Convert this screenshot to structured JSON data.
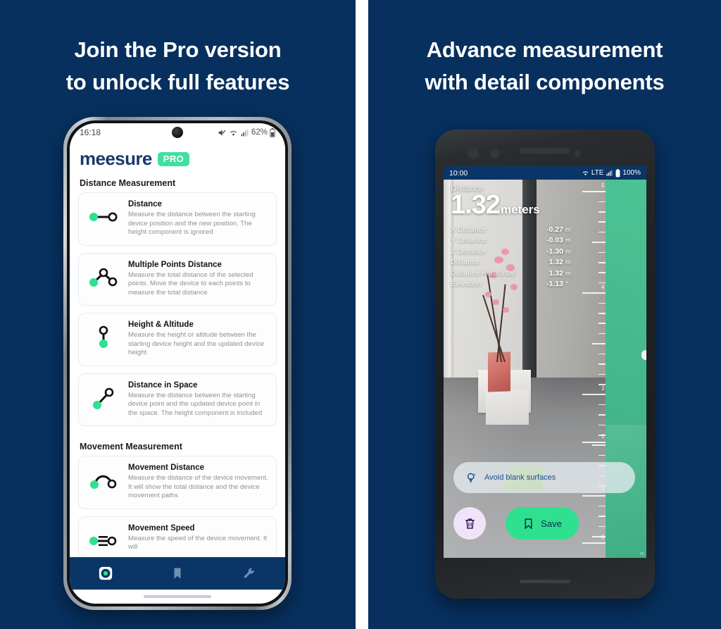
{
  "theme": {
    "background": "#07305e",
    "divider": "#ffffff",
    "brand_navy": "#1a3a6b",
    "accent_green": "#3fe0a0",
    "save_green": "#2fe08f",
    "nav_bar": "#0a3667",
    "ruler_green": "#45b78c"
  },
  "left_panel": {
    "headline_line1": "Join the Pro version",
    "headline_line2": "to unlock full features",
    "phone": {
      "status_bar": {
        "time": "16:18",
        "mute_icon": "mute-icon",
        "wifi_icon": "wifi-icon",
        "signal_icon": "signal-icon",
        "battery_text": "62%",
        "battery_icon": "battery-icon"
      },
      "brand": {
        "name": "meesure",
        "badge": "PRO"
      },
      "sections": [
        {
          "title": "Distance Measurement",
          "cards": [
            {
              "icon": "distance-line-icon",
              "title": "Distance",
              "desc": "Measure the distance between the starting device position and the new position. The height component is ignored"
            },
            {
              "icon": "multi-point-distance-icon",
              "title": "Multiple Points Distance",
              "desc": "Measure the total distance of the selected points. Move the device to each points to measure the total distance"
            },
            {
              "icon": "height-altitude-icon",
              "title": "Height & Altitude",
              "desc": "Measure the height or altitude between the starting device height and the updated device height"
            },
            {
              "icon": "distance-in-space-icon",
              "title": "Distance in Space",
              "desc": "Measure the distance between the starting device point and the updated device point in the space. The height component is included"
            }
          ]
        },
        {
          "title": "Movement Measurement",
          "cards": [
            {
              "icon": "movement-distance-icon",
              "title": "Movement Distance",
              "desc": "Measure the distance of the device movement. It will show the total distance and the device movement paths"
            },
            {
              "icon": "movement-speed-icon",
              "title": "Movement Speed",
              "desc": "Measure the speed of the device movement. It will"
            }
          ]
        }
      ],
      "bottom_nav": [
        {
          "icon": "measure-target-icon",
          "active": true
        },
        {
          "icon": "bookmark-icon",
          "active": false
        },
        {
          "icon": "wrench-icon",
          "active": false
        }
      ]
    }
  },
  "right_panel": {
    "headline_line1": "Advance measurement",
    "headline_line2": "with detail components",
    "phone": {
      "status_bar": {
        "time": "10:00",
        "wifi_icon": "wifi-icon",
        "network_label": "LTE",
        "signal_icon": "signal-icon",
        "battery_icon": "battery-icon",
        "battery_text": "100%"
      },
      "readout": {
        "label": "Distance",
        "value": "1.32",
        "unit": "meters",
        "rows": [
          {
            "key": "X Distance",
            "value": "-0.27",
            "unit": "m"
          },
          {
            "key": "Y Distance",
            "value": "-0.03",
            "unit": "m"
          },
          {
            "key": "Z Distance",
            "value": "-1.30",
            "unit": "m"
          },
          {
            "key": "Distance",
            "value": "1.32",
            "unit": "m"
          },
          {
            "key": "Distance Horizontal",
            "value": "1.32",
            "unit": "m"
          },
          {
            "key": "Elevation",
            "value": "-1.13",
            "unit": "°"
          }
        ]
      },
      "ruler": {
        "labels": [
          "5",
          "4",
          "3",
          "2",
          "1",
          "0"
        ],
        "unit_hint": "meters"
      },
      "hint": {
        "icon": "lightbulb-icon",
        "text": "Avoid blank surfaces"
      },
      "buttons": {
        "delete": {
          "icon": "trash-icon",
          "label": ""
        },
        "save": {
          "icon": "bookmark-icon",
          "label": "Save"
        }
      },
      "watermark": "m"
    }
  }
}
